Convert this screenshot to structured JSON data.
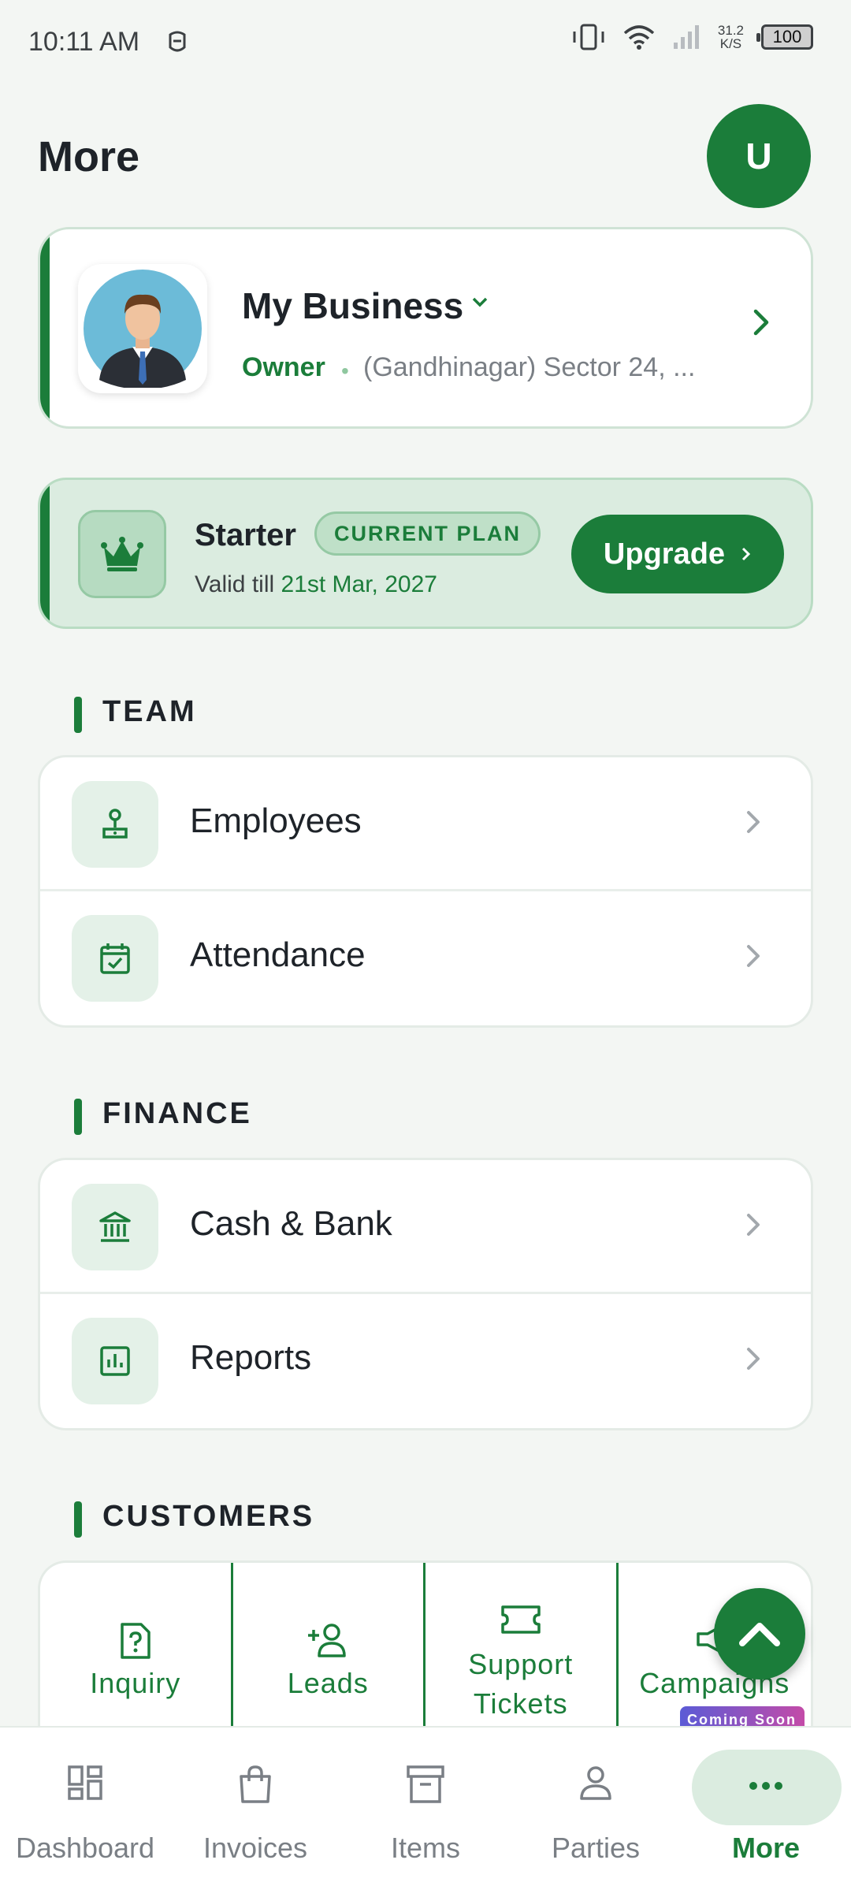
{
  "status_bar": {
    "time": "10:11 AM",
    "speed_value": "31.2",
    "speed_unit": "K/S",
    "battery": "100"
  },
  "header": {
    "title": "More",
    "avatar_initial": "U"
  },
  "business": {
    "name": "My Business",
    "role": "Owner",
    "address": "(Gandhinagar) Sector 24, ..."
  },
  "plan": {
    "name": "Starter",
    "badge": "CURRENT PLAN",
    "valid_prefix": "Valid till",
    "valid_date": "21st Mar, 2027",
    "upgrade_label": "Upgrade"
  },
  "sections": {
    "team": {
      "title": "TEAM",
      "items": [
        {
          "label": "Employees",
          "icon": "employee-icon"
        },
        {
          "label": "Attendance",
          "icon": "calendar-check-icon"
        }
      ]
    },
    "finance": {
      "title": "FINANCE",
      "items": [
        {
          "label": "Cash & Bank",
          "icon": "bank-icon"
        },
        {
          "label": "Reports",
          "icon": "report-chart-icon"
        }
      ]
    },
    "customers": {
      "title": "CUSTOMERS",
      "items": [
        {
          "label": "Inquiry",
          "icon": "inquiry-doc-icon"
        },
        {
          "label": "Leads",
          "icon": "add-person-icon"
        },
        {
          "label_line1": "Support",
          "label_line2": "Tickets",
          "icon": "ticket-icon"
        },
        {
          "label": "Campaigns",
          "icon": "megaphone-icon",
          "badge": "Coming Soon"
        }
      ]
    }
  },
  "bottom_nav": [
    {
      "label": "Dashboard",
      "icon": "dashboard-icon"
    },
    {
      "label": "Invoices",
      "icon": "shopping-bag-icon"
    },
    {
      "label": "Items",
      "icon": "archive-box-icon"
    },
    {
      "label": "Parties",
      "icon": "person-icon"
    },
    {
      "label": "More",
      "icon": "more-dots-icon",
      "active": true
    }
  ],
  "colors": {
    "brand": "#1b7d3a",
    "background": "#f3f6f3",
    "accent_soft": "#dbece0"
  }
}
